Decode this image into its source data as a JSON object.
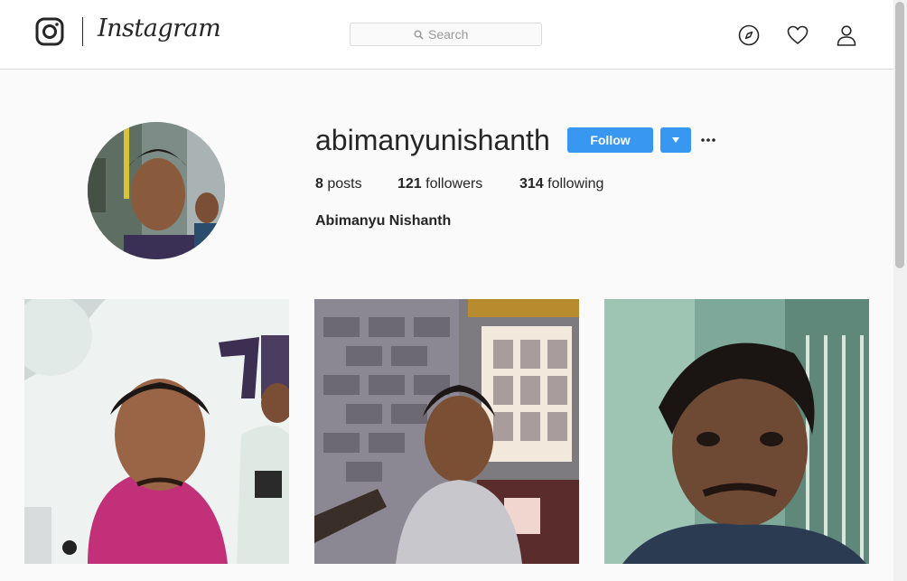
{
  "header": {
    "wordmark": "Instagram",
    "search": {
      "placeholder": "Search"
    },
    "icons": [
      "instagram-glyph-icon",
      "compass-icon",
      "heart-icon",
      "user-icon"
    ]
  },
  "profile": {
    "username": "abimanyunishanth",
    "follow_label": "Follow",
    "full_name": "Abimanyu Nishanth",
    "stats": [
      {
        "count": "8",
        "label": "posts"
      },
      {
        "count": "121",
        "label": "followers"
      },
      {
        "count": "314",
        "label": "following"
      }
    ]
  },
  "colors": {
    "accent": "#3897f0",
    "text": "#262626",
    "background": "#fafafa",
    "border": "#dbdbdb"
  }
}
